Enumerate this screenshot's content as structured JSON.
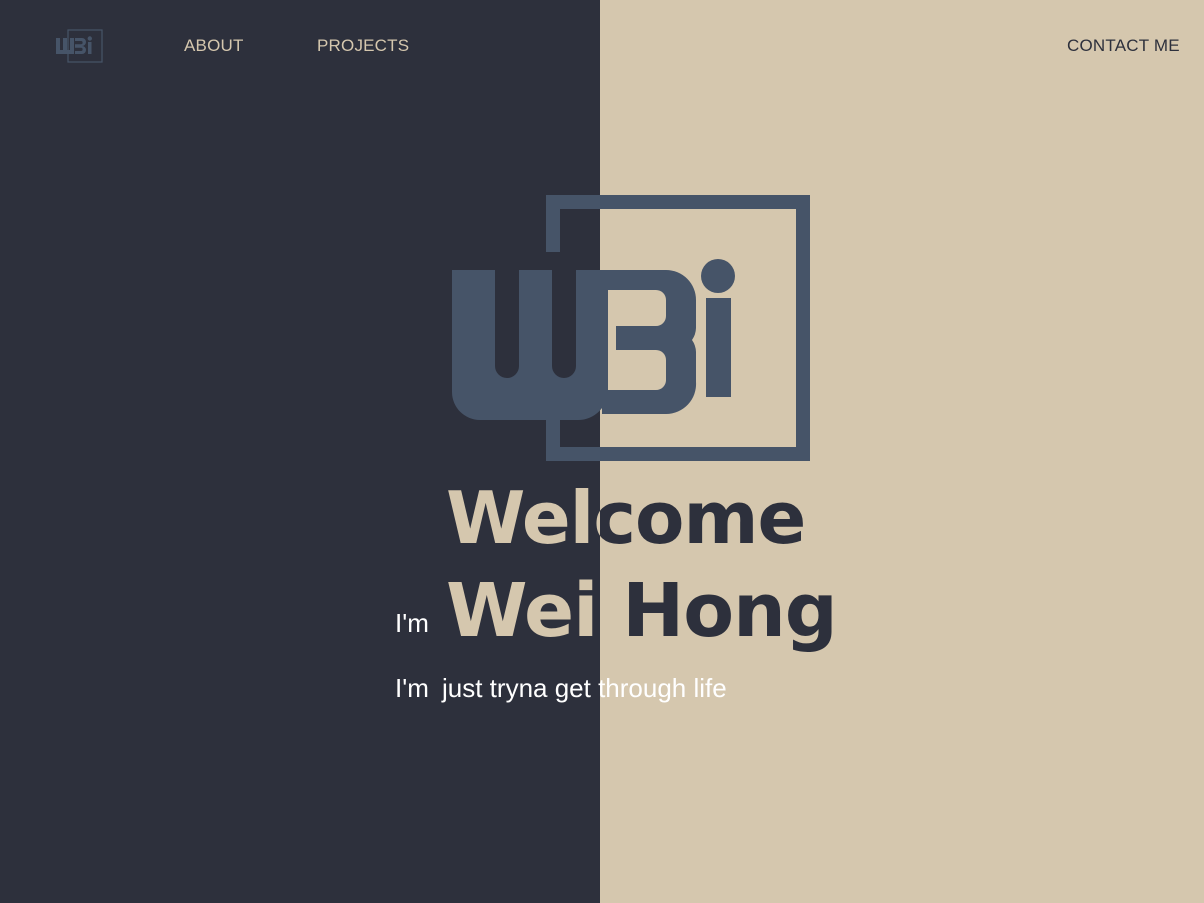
{
  "colors": {
    "dark_bg": "#2d303c",
    "light_bg": "#d5c7ae",
    "logo_blue": "#465468",
    "text_white": "#ffffff"
  },
  "nav": {
    "logo_icon": "wbi-logo-icon",
    "links": [
      {
        "label": "ABOUT"
      },
      {
        "label": "PROJECTS"
      },
      {
        "label": "CONTACT ME"
      }
    ]
  },
  "hero": {
    "logo_icon": "wbi-logo-icon",
    "welcome": "Welcome",
    "im_prefix": "I'm",
    "name": "Wei Hong",
    "tagline_prefix": "I'm",
    "tagline": "just tryna get through life"
  }
}
